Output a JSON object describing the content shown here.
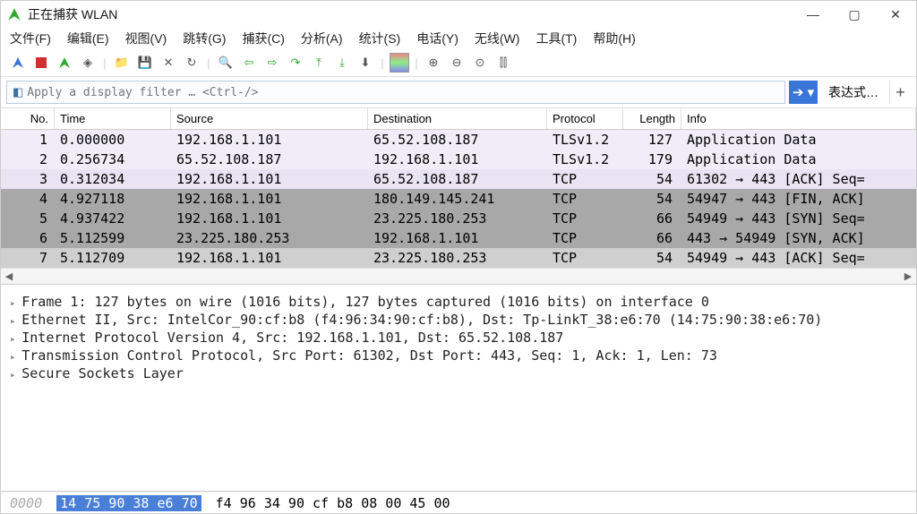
{
  "window": {
    "title": "正在捕获 WLAN"
  },
  "menu": [
    "文件(F)",
    "编辑(E)",
    "视图(V)",
    "跳转(G)",
    "捕获(C)",
    "分析(A)",
    "统计(S)",
    "电话(Y)",
    "无线(W)",
    "工具(T)",
    "帮助(H)"
  ],
  "filter": {
    "placeholder": "Apply a display filter … <Ctrl-/>",
    "expr_label": "表达式…"
  },
  "columns": {
    "no": "No.",
    "time": "Time",
    "src": "Source",
    "dst": "Destination",
    "proto": "Protocol",
    "len": "Length",
    "info": "Info"
  },
  "packets": [
    {
      "no": "1",
      "time": "0.000000",
      "src": "192.168.1.101",
      "dst": "65.52.108.187",
      "proto": "TLSv1.2",
      "len": "127",
      "info": "Application Data",
      "cls": "light"
    },
    {
      "no": "2",
      "time": "0.256734",
      "src": "65.52.108.187",
      "dst": "192.168.1.101",
      "proto": "TLSv1.2",
      "len": "179",
      "info": "Application Data",
      "cls": "light"
    },
    {
      "no": "3",
      "time": "0.312034",
      "src": "192.168.1.101",
      "dst": "65.52.108.187",
      "proto": "TCP",
      "len": "54",
      "info": "61302 → 443 [ACK] Seq=",
      "cls": "lighter"
    },
    {
      "no": "4",
      "time": "4.927118",
      "src": "192.168.1.101",
      "dst": "180.149.145.241",
      "proto": "TCP",
      "len": "54",
      "info": "54947 → 443 [FIN, ACK]",
      "cls": "dark"
    },
    {
      "no": "5",
      "time": "4.937422",
      "src": "192.168.1.101",
      "dst": "23.225.180.253",
      "proto": "TCP",
      "len": "66",
      "info": "54949 → 443 [SYN] Seq=",
      "cls": "dark"
    },
    {
      "no": "6",
      "time": "5.112599",
      "src": "23.225.180.253",
      "dst": "192.168.1.101",
      "proto": "TCP",
      "len": "66",
      "info": "443 → 54949 [SYN, ACK]",
      "cls": "dark"
    },
    {
      "no": "7",
      "time": "5.112709",
      "src": "192.168.1.101",
      "dst": "23.225.180.253",
      "proto": "TCP",
      "len": "54",
      "info": "54949 → 443 [ACK] Seq=",
      "cls": "med"
    }
  ],
  "details": [
    "Frame 1: 127 bytes on wire (1016 bits), 127 bytes captured (1016 bits) on interface 0",
    "Ethernet II, Src: IntelCor_90:cf:b8 (f4:96:34:90:cf:b8), Dst: Tp-LinkT_38:e6:70 (14:75:90:38:e6:70)",
    "Internet Protocol Version 4, Src: 192.168.1.101, Dst: 65.52.108.187",
    "Transmission Control Protocol, Src Port: 61302, Dst Port: 443, Seq: 1, Ack: 1, Len: 73",
    "Secure Sockets Layer"
  ],
  "hex": {
    "offset": "0000",
    "selected": "14 75 90 38 e6 70",
    "rest": "f4 96  34 90 cf b8 08 00 45 00"
  }
}
